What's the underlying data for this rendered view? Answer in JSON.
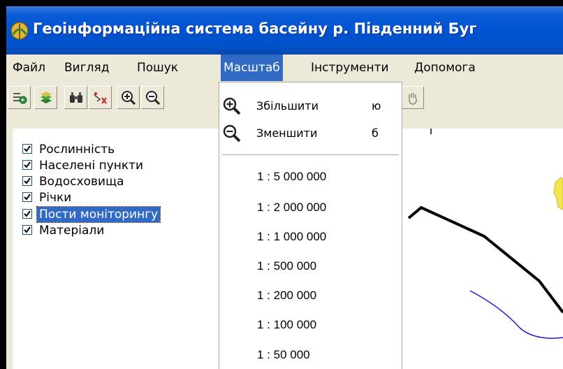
{
  "window": {
    "title": "Геоінформаційна система басейну р. Південний Буг"
  },
  "menu": [
    {
      "label": "Файл",
      "active": false
    },
    {
      "label": "Вигляд",
      "active": false
    },
    {
      "label": "Пошук",
      "active": false
    },
    {
      "label": "Масштаб",
      "active": true
    },
    {
      "label": "Інструменти",
      "active": false
    },
    {
      "label": "Допомога",
      "active": false
    }
  ],
  "toolbar": {
    "buttons": [
      "layers-open-icon",
      "layer-icon",
      "binoculars-icon",
      "measure-icon",
      "zoom-in-icon",
      "zoom-out-icon",
      "pan-icon"
    ]
  },
  "layers": [
    {
      "label": "Рослинність",
      "checked": true,
      "selected": false
    },
    {
      "label": "Населені пункти",
      "checked": true,
      "selected": false
    },
    {
      "label": "Водосховища",
      "checked": true,
      "selected": false
    },
    {
      "label": "Річки",
      "checked": true,
      "selected": false
    },
    {
      "label": "Пости моніторингу",
      "checked": true,
      "selected": true
    },
    {
      "label": "Матеріали",
      "checked": true,
      "selected": false
    }
  ],
  "scale_menu": {
    "zoom_in": {
      "label": "Збільшити",
      "shortcut": "ю",
      "icon": "zoom-in-icon"
    },
    "zoom_out": {
      "label": "Зменшити",
      "shortcut": "б",
      "icon": "zoom-out-icon"
    },
    "scales": [
      "1 : 5 000 000",
      "1 : 2 000 000",
      "1 : 1 000 000",
      "1 : 500 000",
      "1 : 200 000",
      "1 : 100 000",
      "1 : 50 000"
    ]
  },
  "colors": {
    "titlebar": "#0053d2",
    "selection": "#316ac5",
    "river": "#1a1ad0",
    "boundary": "#000000",
    "settlement": "#f2e64a"
  }
}
